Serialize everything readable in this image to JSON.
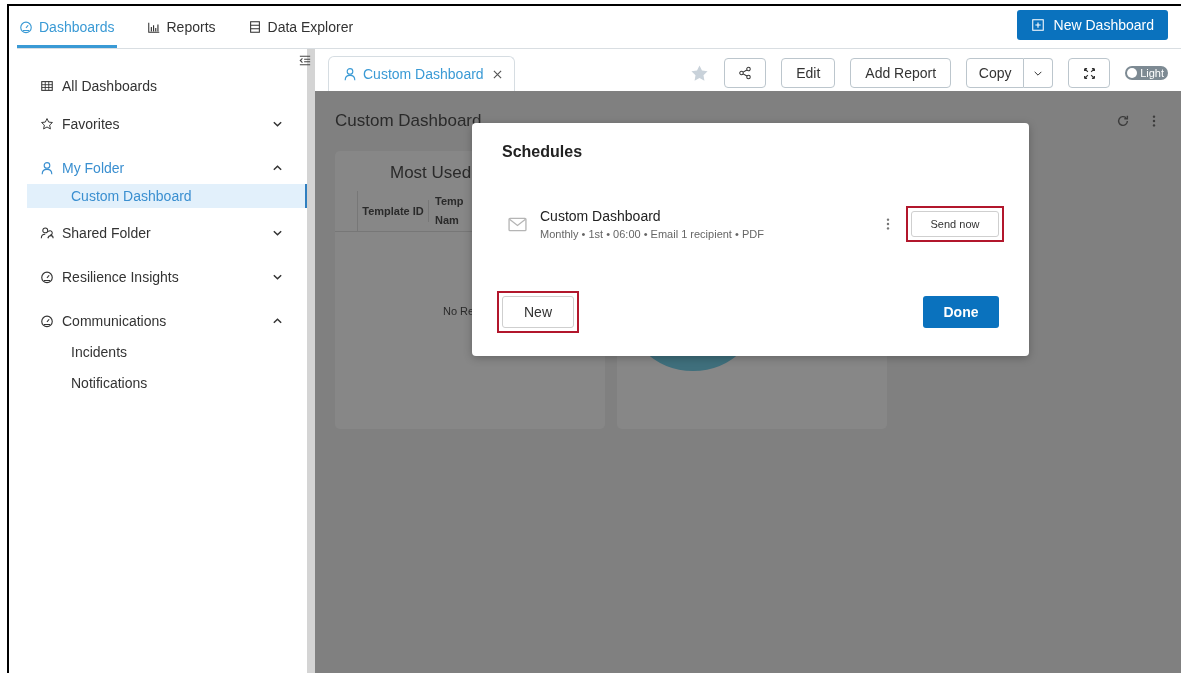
{
  "nav": {
    "tabs": [
      {
        "label": "Dashboards",
        "selected": true
      },
      {
        "label": "Reports",
        "selected": false
      },
      {
        "label": "Data Explorer",
        "selected": false
      }
    ],
    "new_button": "New Dashboard"
  },
  "sidebar": {
    "items": [
      {
        "label": "All Dashboards",
        "kind": "link",
        "selected": false
      },
      {
        "label": "Favorites",
        "kind": "folder",
        "expanded": false,
        "selected": false
      },
      {
        "label": "My Folder",
        "kind": "folder",
        "expanded": true,
        "selected": true,
        "children": [
          {
            "label": "Custom Dashboard",
            "selected": true
          }
        ]
      },
      {
        "label": "Shared Folder",
        "kind": "folder",
        "expanded": false,
        "selected": false
      },
      {
        "label": "Resilience Insights",
        "kind": "folder",
        "expanded": false,
        "selected": false
      },
      {
        "label": "Communications",
        "kind": "folder",
        "expanded": true,
        "selected": false,
        "children": [
          {
            "label": "Incidents",
            "selected": false
          },
          {
            "label": "Notifications",
            "selected": false
          }
        ]
      }
    ]
  },
  "open_tab": {
    "label": "Custom Dashboard",
    "selected": true
  },
  "toolbar": {
    "favorite": false,
    "edit": "Edit",
    "add_report": "Add Report",
    "copy": "Copy",
    "theme_toggle": {
      "label": "Light",
      "on": false
    }
  },
  "dashboard": {
    "title": "Custom Dashboard",
    "cards": [
      {
        "kind": "table",
        "title": "Most Used",
        "columns": [
          "Template ID",
          "Temp Nam"
        ],
        "empty_text": "No Re"
      },
      {
        "kind": "donut"
      }
    ]
  },
  "dialog": {
    "title": "Schedules",
    "schedules": [
      {
        "name": "Custom Dashboard",
        "details": "Monthly • 1st • 06:00 • Email 1 recipient • PDF",
        "send_button": {
          "label": "Send now",
          "highlighted": true
        }
      }
    ],
    "new_button": {
      "label": "New",
      "highlighted": true
    },
    "done_button": {
      "label": "Done"
    }
  }
}
